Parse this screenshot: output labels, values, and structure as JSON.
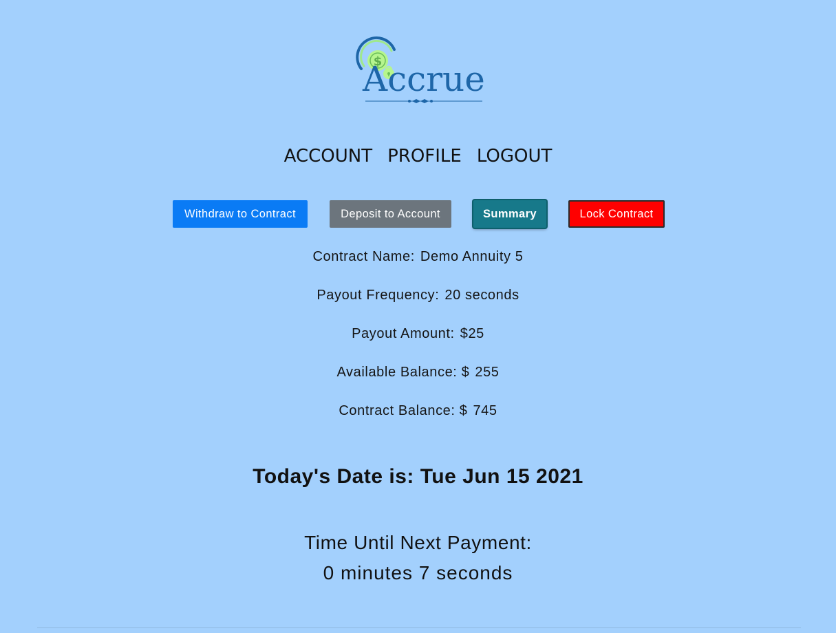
{
  "brand": {
    "logo_text": "Accrue",
    "colors": {
      "primary": "#1e66a8",
      "accent_green": "#b6f58e",
      "background": "#a3d0fd"
    }
  },
  "nav": {
    "items": [
      {
        "label": "ACCOUNT"
      },
      {
        "label": "PROFILE"
      },
      {
        "label": "LOGOUT"
      }
    ]
  },
  "actions": {
    "withdraw_label": "Withdraw to Contract",
    "deposit_label": "Deposit to Account",
    "summary_label": "Summary",
    "lock_label": "Lock Contract",
    "colors": {
      "withdraw": "#0a7bf5",
      "deposit": "#6c757d",
      "summary": "#17798a",
      "lock": "#ff0000"
    }
  },
  "summary": {
    "contract_name_label": "Contract Name:",
    "contract_name_value": "Demo Annuity 5",
    "payout_frequency_label": "Payout Frequency:",
    "payout_frequency_value": "20 seconds",
    "payout_amount_label": "Payout Amount:",
    "payout_amount_value": "$25",
    "available_balance_label": "Available Balance: $",
    "available_balance_value": "255",
    "contract_balance_label": "Contract Balance: $",
    "contract_balance_value": "745"
  },
  "date": {
    "text": "Today's Date is: Tue Jun 15 2021"
  },
  "timer": {
    "label": "Time Until Next Payment:",
    "value": "0 minutes 7 seconds"
  }
}
